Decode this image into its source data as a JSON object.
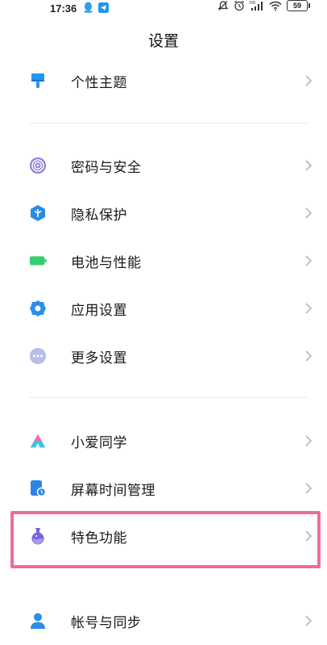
{
  "status_bar": {
    "time": "17:36",
    "battery": "59",
    "signal_label": "HD"
  },
  "header": {
    "title": "设置"
  },
  "groups": [
    {
      "items": [
        {
          "label": "个性主题",
          "icon": "paint-brush-icon",
          "color": "#2196f3"
        }
      ]
    },
    {
      "items": [
        {
          "label": "密码与安全",
          "icon": "fingerprint-icon",
          "color": "#7a6fd6"
        },
        {
          "label": "隐私保护",
          "icon": "privacy-shield-icon",
          "color": "#2a8be6"
        },
        {
          "label": "电池与性能",
          "icon": "battery-icon",
          "color": "#31d06c"
        },
        {
          "label": "应用设置",
          "icon": "gear-icon",
          "color": "#2b8fe8"
        },
        {
          "label": "更多设置",
          "icon": "more-dots-icon",
          "color": "#b7bce8"
        }
      ]
    },
    {
      "items": [
        {
          "label": "小爱同学",
          "icon": "xiaoai-icon",
          "color": "#4a8cf7"
        },
        {
          "label": "屏幕时间管理",
          "icon": "screen-time-icon",
          "color": "#2b86e6"
        },
        {
          "label": "特色功能",
          "icon": "flask-icon",
          "color": "#7b63dd"
        }
      ]
    },
    {
      "items": [
        {
          "label": "帐号与同步",
          "icon": "account-icon",
          "color": "#2b8fe8"
        }
      ]
    }
  ],
  "highlight_color": "#f06a98"
}
